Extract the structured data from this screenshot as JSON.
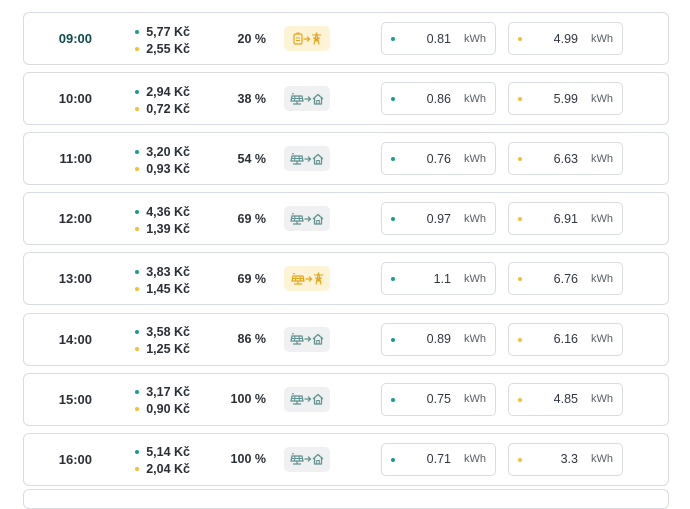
{
  "unit": "kWh",
  "rows": [
    {
      "time": "09:00",
      "current": true,
      "price_buy": "5,77 Kč",
      "price_sell": "2,55 Kč",
      "soc": "20 %",
      "mode_icon": "battery-to-grid-icon",
      "mode_alt": true,
      "energy_teal": "0.81",
      "energy_yellow": "4.99"
    },
    {
      "time": "10:00",
      "current": false,
      "price_buy": "2,94 Kč",
      "price_sell": "0,72 Kč",
      "soc": "38 %",
      "mode_icon": "solar-to-home-icon",
      "mode_alt": false,
      "energy_teal": "0.86",
      "energy_yellow": "5.99"
    },
    {
      "time": "11:00",
      "current": false,
      "price_buy": "3,20 Kč",
      "price_sell": "0,93 Kč",
      "soc": "54 %",
      "mode_icon": "solar-to-home-icon",
      "mode_alt": false,
      "energy_teal": "0.76",
      "energy_yellow": "6.63"
    },
    {
      "time": "12:00",
      "current": false,
      "price_buy": "4,36 Kč",
      "price_sell": "1,39 Kč",
      "soc": "69 %",
      "mode_icon": "solar-to-home-icon",
      "mode_alt": false,
      "energy_teal": "0.97",
      "energy_yellow": "6.91"
    },
    {
      "time": "13:00",
      "current": false,
      "price_buy": "3,83 Kč",
      "price_sell": "1,45 Kč",
      "soc": "69 %",
      "mode_icon": "solar-to-grid-icon",
      "mode_alt": true,
      "energy_teal": "1.1",
      "energy_yellow": "6.76"
    },
    {
      "time": "14:00",
      "current": false,
      "price_buy": "3,58 Kč",
      "price_sell": "1,25 Kč",
      "soc": "86 %",
      "mode_icon": "solar-to-home-icon",
      "mode_alt": false,
      "energy_teal": "0.89",
      "energy_yellow": "6.16"
    },
    {
      "time": "15:00",
      "current": false,
      "price_buy": "3,17 Kč",
      "price_sell": "0,90 Kč",
      "soc": "100 %",
      "mode_icon": "solar-to-home-icon",
      "mode_alt": false,
      "energy_teal": "0.75",
      "energy_yellow": "4.85"
    },
    {
      "time": "16:00",
      "current": false,
      "price_buy": "5,14 Kč",
      "price_sell": "2,04 Kč",
      "soc": "100 %",
      "mode_icon": "solar-to-home-icon",
      "mode_alt": false,
      "energy_teal": "0.71",
      "energy_yellow": "3.3"
    }
  ]
}
